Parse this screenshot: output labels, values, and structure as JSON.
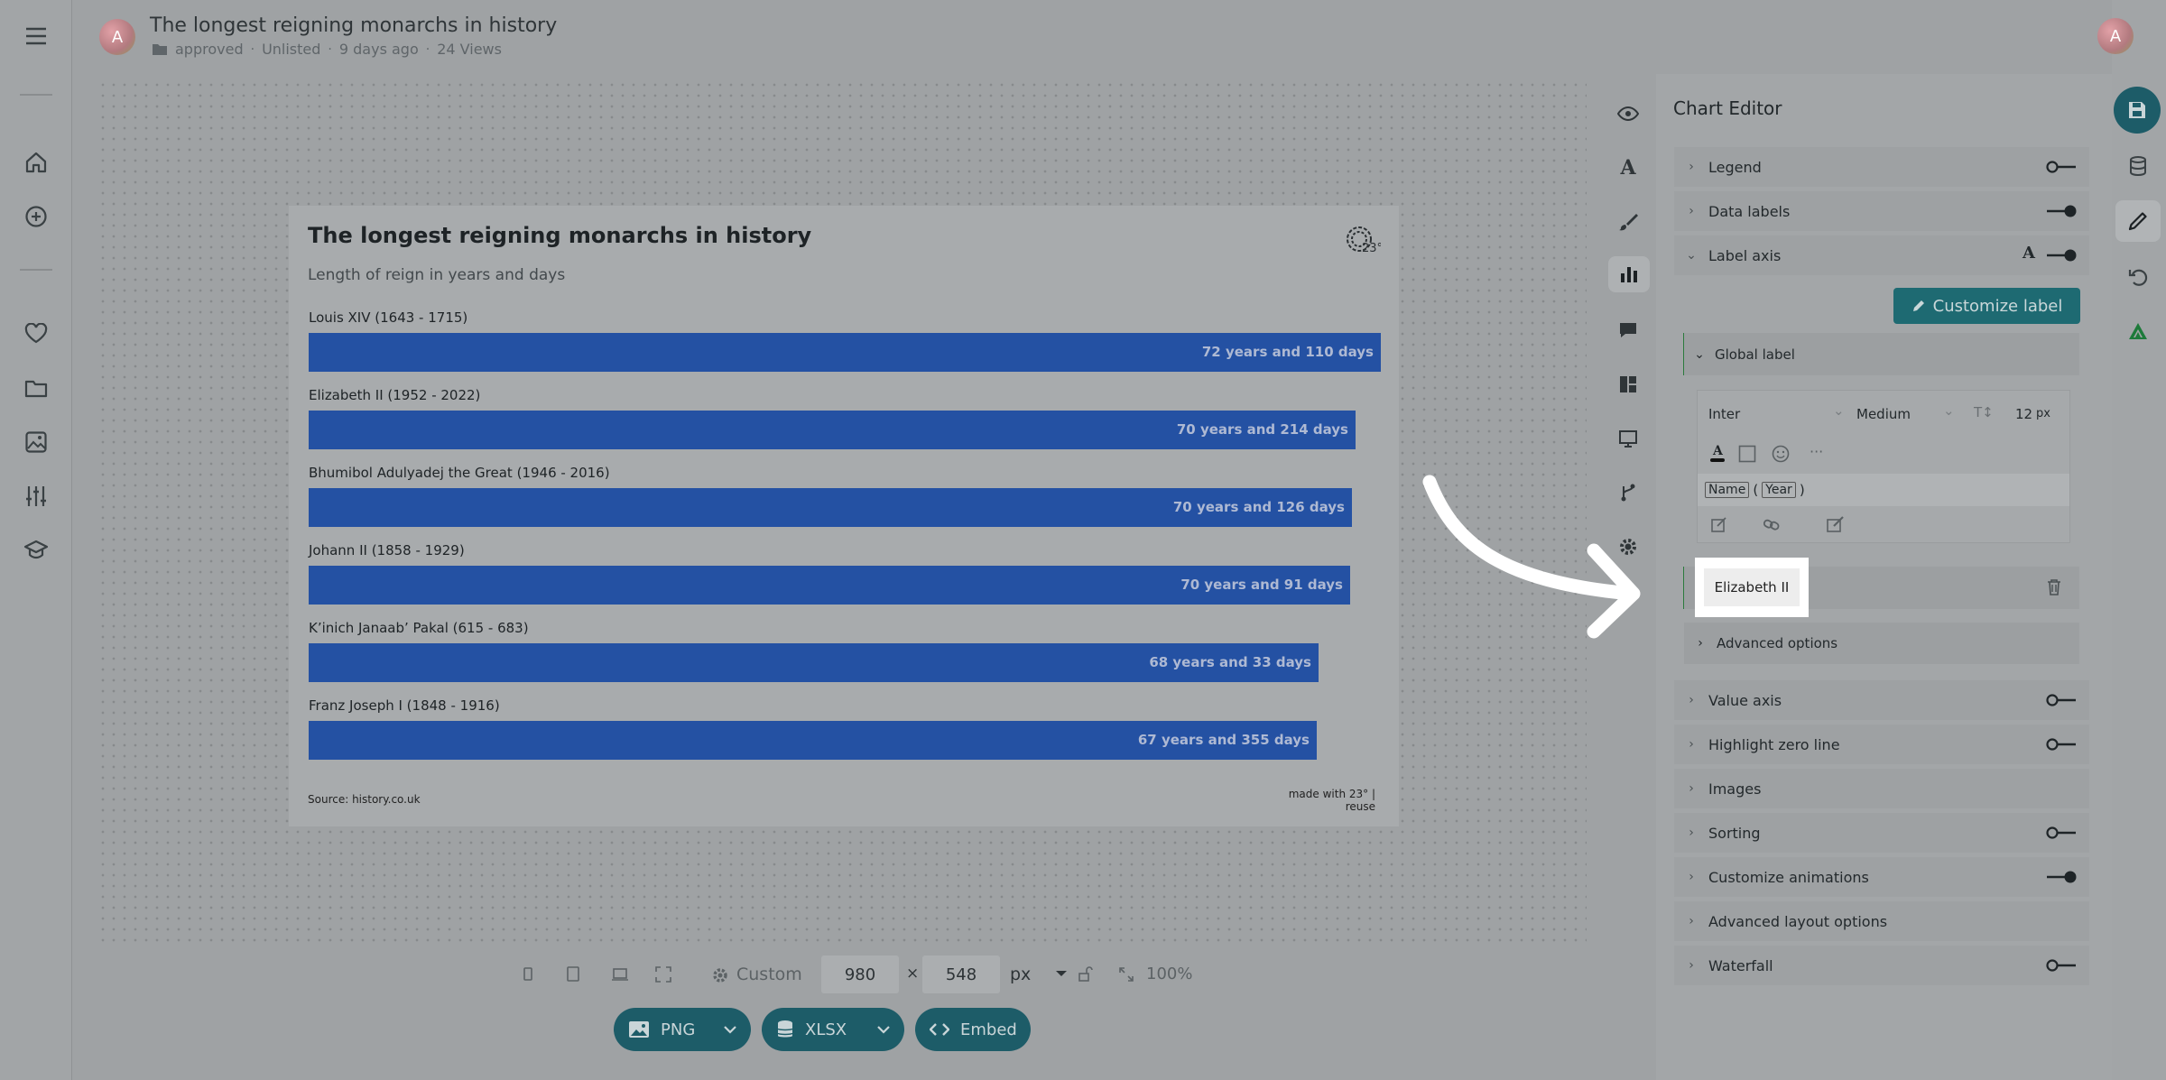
{
  "header": {
    "avatar_letter": "A",
    "title": "The longest reigning monarchs in history",
    "folder": "approved",
    "visibility": "Unlisted",
    "updated": "9 days ago",
    "views": "24 Views",
    "user_avatar_letter": "A"
  },
  "left_nav": {
    "items": [
      "menu-icon",
      "home-icon",
      "plus-circle-icon",
      "heart-icon",
      "folder-icon",
      "image-icon",
      "sliders-icon",
      "graduation-cap-icon"
    ]
  },
  "chart": {
    "brand_mark": "23°"
  },
  "chart_data": {
    "type": "bar",
    "orientation": "horizontal",
    "title": "The longest reigning monarchs in history",
    "subtitle": "Length of reign in years and days",
    "categories": [
      "Louis XIV (1643 - 1715)",
      "Elizabeth II (1952 - 2022)",
      "Bhumibol Adulyadej the Great (1946 - 2016)",
      "Johann II (1858 - 1929)",
      "K’inich Janaab’ Pakal (615 - 683)",
      "Franz Joseph I (1848 - 1916)"
    ],
    "values": [
      72.3,
      70.59,
      70.35,
      70.25,
      68.09,
      67.97
    ],
    "data_labels": [
      "72 years and 110 days",
      "70 years and 214 days",
      "70 years and 126 days",
      "70 years and 91 days",
      "68 years and 33 days",
      "67 years and 355 days"
    ],
    "xlim": [
      0,
      72.3
    ],
    "bar_color": "#2451a3",
    "grid": false,
    "legend": "none",
    "source": "Source: history.co.uk",
    "credit": "made with 23° | reuse"
  },
  "toolbar": {
    "preset": "Custom",
    "width": "980",
    "times": "×",
    "height": "548",
    "unit": "px",
    "zoom": "100%",
    "png_label": "PNG",
    "xlsx_label": "XLSX",
    "embed_label": "Embed"
  },
  "editor": {
    "title": "Chart Editor",
    "legend": "Legend",
    "data_labels": "Data labels",
    "label_axis": "Label axis",
    "customize_label": "Customize label",
    "global_label": "Global label",
    "font": "Inter",
    "weight": "Medium",
    "font_size": "12",
    "font_unit": "px",
    "more": "···",
    "token_name": "Name",
    "token_open": "(",
    "token_year": "Year",
    "token_close": ")",
    "elizabeth": "Elizabeth II",
    "advanced_options": "Advanced options",
    "value_axis": "Value axis",
    "highlight_zero": "Highlight zero line",
    "images": "Images",
    "sorting": "Sorting",
    "animations": "Customize animations",
    "advanced_layout": "Advanced layout options",
    "waterfall": "Waterfall"
  },
  "colors": {
    "accent": "#1d5c68",
    "bar": "#2451a3",
    "highlight": "#ffffff"
  }
}
